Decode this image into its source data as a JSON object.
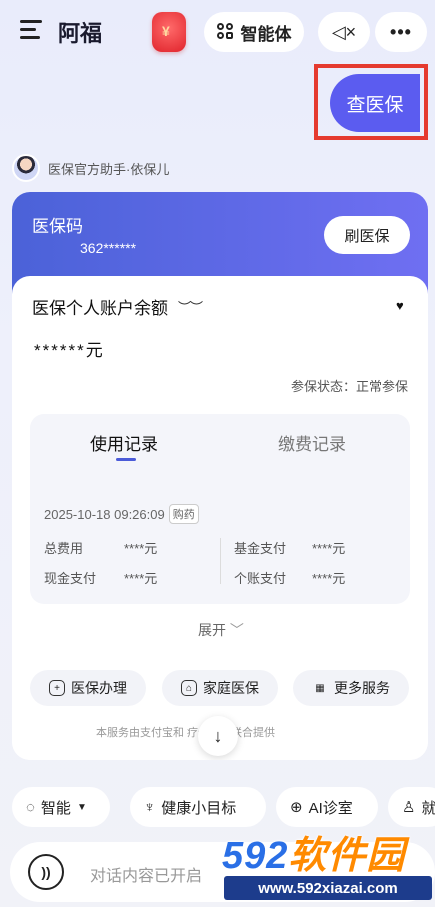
{
  "header": {
    "app_title": "阿福",
    "agent_label": "智能体",
    "more_label": "•••"
  },
  "query_button": "查医保",
  "assistant": {
    "name": "医保官方助手·依保儿"
  },
  "card": {
    "code_label": "医保码",
    "code_number": "362******",
    "swipe_label": "刷医保",
    "balance_title": "医保个人账户余额",
    "balance_value": "******元",
    "status": "参保状态：正常参保",
    "tabs": [
      "使用记录",
      "缴费记录"
    ],
    "record": {
      "time": "2025-10-18 09:26:09",
      "tag": "购药",
      "total_label": "总费用",
      "total_value": "****元",
      "fund_label": "基金支付",
      "fund_value": "****元",
      "cash_label": "现金支付",
      "cash_value": "****元",
      "personal_label": "个账支付",
      "personal_value": "****元"
    },
    "expand_label": "展开",
    "services": [
      "医保办理",
      "家庭医保",
      "更多服务"
    ],
    "footnote": "本服务由支付宝和              疗保障局联合提供"
  },
  "chips": [
    "智能",
    "健康小目标",
    "AI诊室",
    "就"
  ],
  "input": {
    "placeholder": "对话内容已开启"
  },
  "watermark": {
    "brand_num": "592",
    "brand_text": "软件园",
    "url": "www.592xiazai.com"
  },
  "icons": [
    "menu-icon",
    "hongbao-icon",
    "agent-icon",
    "mute-icon",
    "more-icon",
    "eye-closed-icon",
    "dropdown-icon",
    "chevron-down-icon",
    "download-icon",
    "mic-icon"
  ]
}
